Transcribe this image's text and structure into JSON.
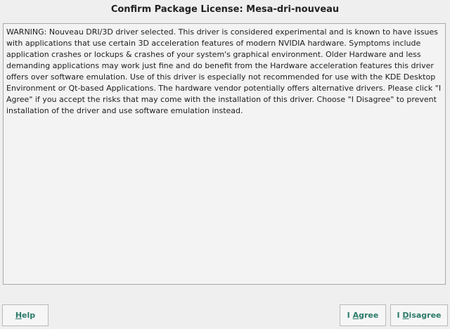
{
  "dialog": {
    "title": "Confirm Package License: Mesa-dri-nouveau"
  },
  "license": {
    "text": "WARNING: Nouveau DRI/3D driver selected. This driver is considered experimental and is known to have issues with applications that use certain 3D acceleration features of modern NVIDIA hardware. Symptoms include application crashes or lockups & crashes of your system's graphical environment. Older Hardware and less demanding applications may work just fine and do benefit from the Hardware acceleration features this driver offers over software emulation. Use of this driver is especially not recommended for use with the KDE Desktop Environment or Qt-based Applications. The hardware vendor potentially offers alternative drivers. Please click \"I Agree\" if you accept the risks that may come with the installation of this driver. Choose \"I Disagree\" to prevent installation of the driver and use software emulation instead."
  },
  "buttons": {
    "help": {
      "pre": "",
      "mnemonic": "H",
      "post": "elp"
    },
    "agree": {
      "pre": "I ",
      "mnemonic": "A",
      "post": "gree"
    },
    "disagree": {
      "pre": "I ",
      "mnemonic": "D",
      "post": "isagree"
    }
  },
  "colors": {
    "button_text": "#2c7a6a",
    "background": "#efefef"
  }
}
